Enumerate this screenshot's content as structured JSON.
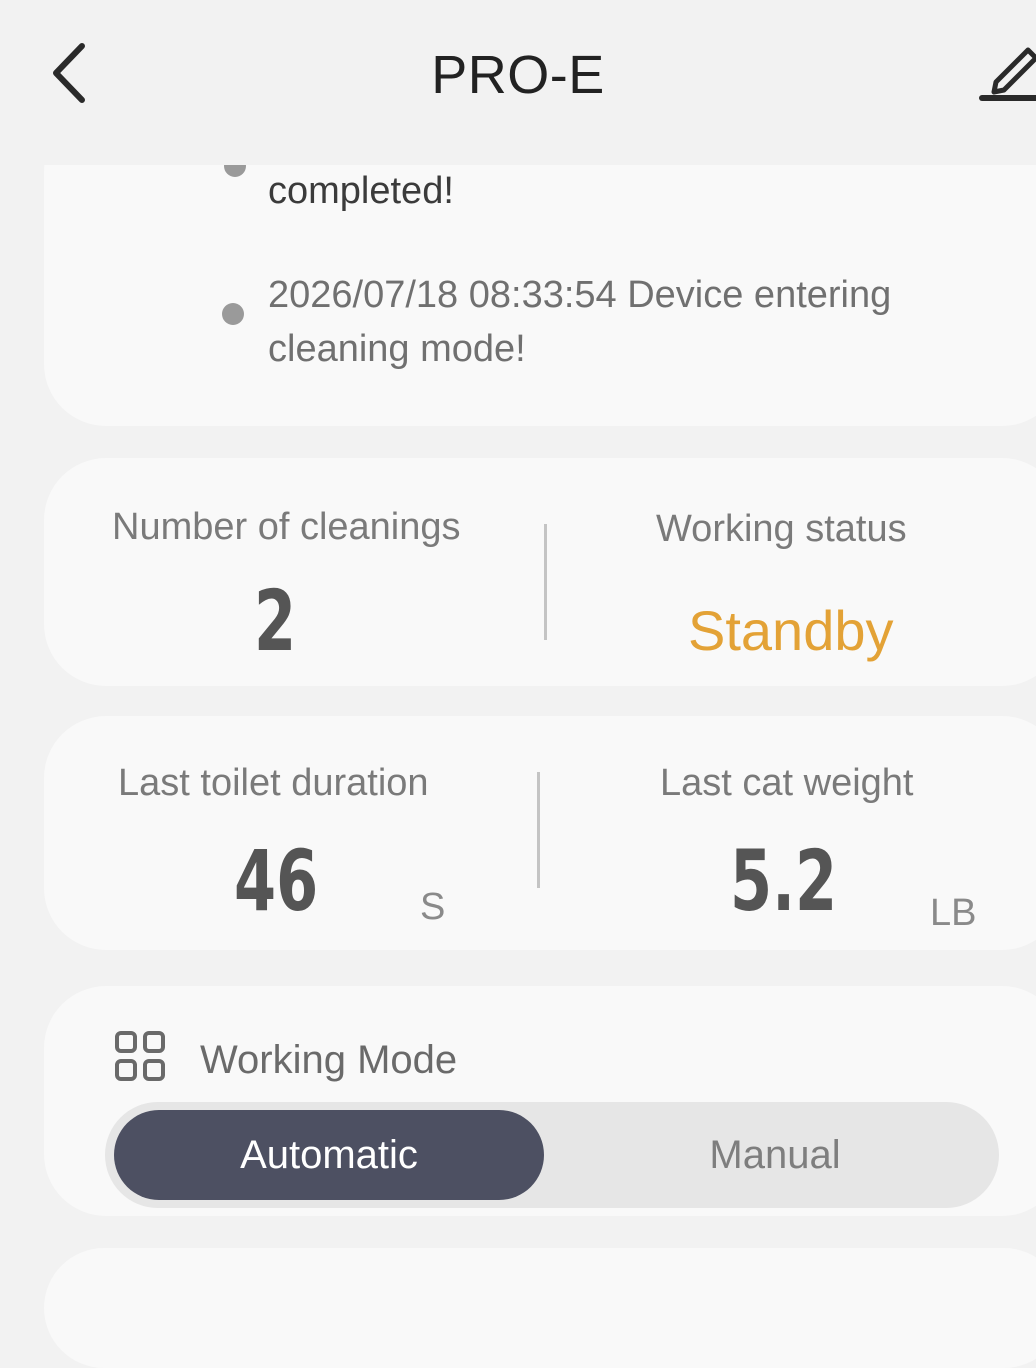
{
  "header": {
    "title": "PRO-E",
    "back_icon": "chevron-left-icon",
    "edit_icon": "pencil-icon"
  },
  "log": {
    "entries": [
      {
        "text": "completed!"
      },
      {
        "text": "2026/07/18 08:33:54 Device entering cleaning mode!"
      }
    ]
  },
  "stats": {
    "cleanings_label": "Number of cleanings",
    "cleanings_value": "2",
    "status_label": "Working status",
    "status_value": "Standby",
    "duration_label": "Last toilet duration",
    "duration_value": "46",
    "duration_unit": "S",
    "weight_label": "Last cat weight",
    "weight_value": "5.2",
    "weight_unit": "LB"
  },
  "mode": {
    "icon": "grid-icon",
    "title": "Working Mode",
    "options": [
      "Automatic",
      "Manual"
    ],
    "selected": "Automatic"
  },
  "colors": {
    "background": "#f2f2f2",
    "card": "#f9f9f9",
    "status_accent": "#e3a236",
    "selected_segment": "#4d5062"
  }
}
